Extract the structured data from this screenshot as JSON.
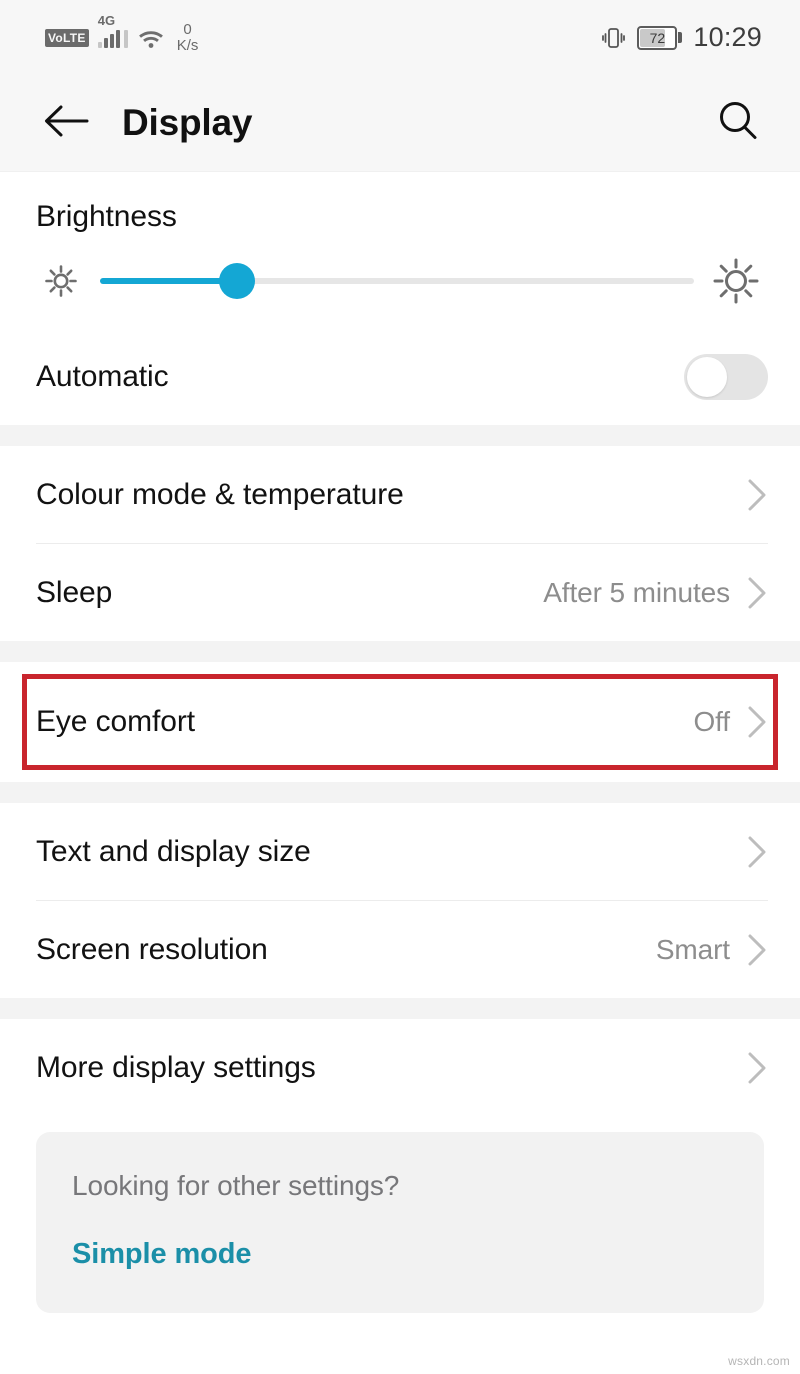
{
  "status_bar": {
    "volte_label": "VoLTE",
    "network_label": "4G",
    "data_rate_value": "0",
    "data_rate_unit": "K/s",
    "battery_percent": "72",
    "clock": "10:29",
    "icons": {
      "signal": "signal-bars-icon",
      "wifi": "wifi-icon",
      "vibrate": "vibrate-icon",
      "battery": "battery-icon"
    }
  },
  "app_bar": {
    "back_icon": "arrow-left-icon",
    "title": "Display",
    "search_icon": "search-icon"
  },
  "brightness": {
    "title": "Brightness",
    "low_icon": "sun-small-icon",
    "high_icon": "sun-large-icon",
    "slider_percent": 23,
    "accent_color": "#14a7d4",
    "automatic": {
      "label": "Automatic",
      "state": "off"
    }
  },
  "sections": [
    {
      "rows": [
        {
          "label": "Colour mode & temperature",
          "value": "",
          "chevron": "chevron-right-icon"
        },
        {
          "label": "Sleep",
          "value": "After 5 minutes",
          "chevron": "chevron-right-icon"
        }
      ]
    },
    {
      "rows": [
        {
          "label": "Eye comfort",
          "value": "Off",
          "chevron": "chevron-right-icon",
          "highlighted": true
        }
      ]
    },
    {
      "rows": [
        {
          "label": "Text and display size",
          "value": "",
          "chevron": "chevron-right-icon"
        },
        {
          "label": "Screen resolution",
          "value": "Smart",
          "chevron": "chevron-right-icon"
        }
      ]
    },
    {
      "rows": [
        {
          "label": "More display settings",
          "value": "",
          "chevron": "chevron-right-icon"
        }
      ]
    }
  ],
  "promo": {
    "question": "Looking for other settings?",
    "link_label": "Simple mode",
    "link_color": "#1b8fa8"
  },
  "highlight": {
    "color": "#c9252d"
  },
  "watermark": "wsxdn.com"
}
